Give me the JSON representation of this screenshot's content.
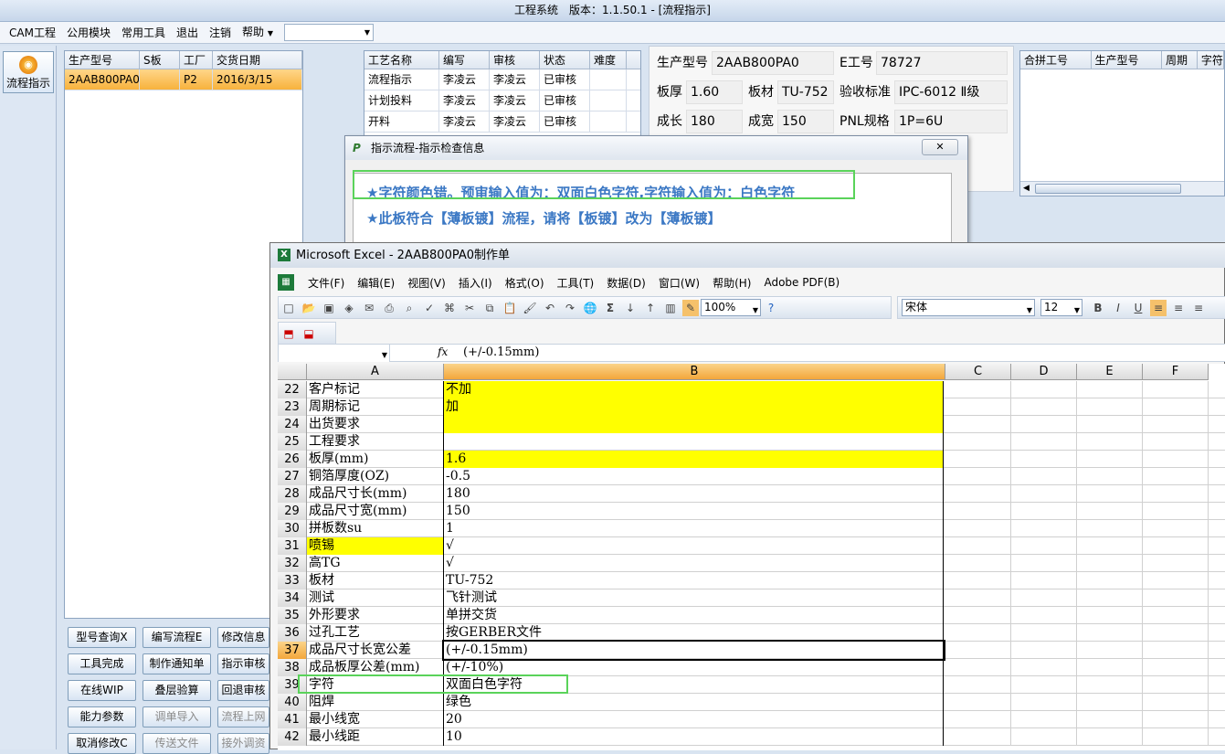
{
  "app": {
    "title": "工程系统　版本：1.1.50.1 - [流程指示]",
    "menu": [
      "CAM工程",
      "公用模块",
      "常用工具",
      "退出",
      "注销",
      "帮助"
    ]
  },
  "side": {
    "button_label": "流程指示"
  },
  "order_grid": {
    "headers": [
      "生产型号",
      "S板",
      "工厂",
      "交货日期"
    ],
    "rows": [
      [
        "2AAB800PA0",
        "",
        "P2",
        "2016/3/15"
      ]
    ]
  },
  "process_grid": {
    "headers": [
      "工艺名称",
      "编写",
      "审核",
      "状态",
      "难度"
    ],
    "rows": [
      [
        "流程指示",
        "李凌云",
        "李凌云",
        "已审核",
        ""
      ],
      [
        "计划投料",
        "李凌云",
        "李凌云",
        "已审核",
        ""
      ],
      [
        "开料",
        "李凌云",
        "李凌云",
        "已审核",
        ""
      ]
    ]
  },
  "info": {
    "model_label": "生产型号",
    "model_value": "2AAB800PA0",
    "e_label": "E工号",
    "e_value": "78727",
    "thickness_label": "板厚",
    "thickness_value": "1.60",
    "material_label": "板材",
    "material_value": "TU-752",
    "standard_label": "验收标准",
    "standard_value": "IPC-6012 Ⅱ级",
    "length_label": "成长",
    "length_value": "180",
    "width_label": "成宽",
    "width_value": "150",
    "pnl_label": "PNL规格",
    "pnl_value": "1P=6U"
  },
  "combine_grid": {
    "headers": [
      "合拼工号",
      "生产型号",
      "周期",
      "字符"
    ]
  },
  "buttons": [
    [
      "型号查询X",
      "编写流程E",
      "修改信息"
    ],
    [
      "工具完成",
      "制作通知单",
      "指示审核"
    ],
    [
      "在线WIP",
      "叠层验算",
      "回退审核"
    ],
    [
      "能力参数",
      "调单导入",
      "流程上网"
    ],
    [
      "取消修改C",
      "传送文件",
      "接外调资"
    ]
  ],
  "dialog": {
    "title": "指示流程-指示检查信息",
    "messages": [
      "★字符颜色错。预审输入值为：双面白色字符,字符输入值为：白色字符",
      "★此板符合【薄板镀】流程，请将【板镀】改为【薄板镀】"
    ]
  },
  "excel": {
    "title": "Microsoft Excel - 2AAB800PA0制作单",
    "menu": [
      "文件(F)",
      "编辑(E)",
      "视图(V)",
      "插入(I)",
      "格式(O)",
      "工具(T)",
      "数据(D)",
      "窗口(W)",
      "帮助(H)",
      "Adobe PDF(B)"
    ],
    "zoom": "100%",
    "font": "宋体",
    "font_size": "12",
    "formula": "(+/-0.15mm)",
    "columns": [
      "A",
      "B",
      "C",
      "D",
      "E",
      "F"
    ],
    "rows": [
      {
        "n": "22",
        "a": "客户标记",
        "b": "不加",
        "yb": true
      },
      {
        "n": "23",
        "a": "周期标记",
        "b": "加",
        "yb": true
      },
      {
        "n": "24",
        "a": "出货要求",
        "b": "",
        "yb": true
      },
      {
        "n": "25",
        "a": "工程要求",
        "b": ""
      },
      {
        "n": "26",
        "a": "板厚(mm)",
        "b": "1.6",
        "yb": true
      },
      {
        "n": "27",
        "a": "铜箔厚度(OZ)",
        "b": "-0.5"
      },
      {
        "n": "28",
        "a": "成品尺寸长(mm)",
        "b": "180"
      },
      {
        "n": "29",
        "a": "成品尺寸宽(mm)",
        "b": "150"
      },
      {
        "n": "30",
        "a": "拼板数su",
        "b": "1"
      },
      {
        "n": "31",
        "a": "喷锡",
        "b": "√",
        "ya": true
      },
      {
        "n": "32",
        "a": "高TG",
        "b": "√"
      },
      {
        "n": "33",
        "a": "板材",
        "b": "TU-752"
      },
      {
        "n": "34",
        "a": "测试",
        "b": "飞针测试"
      },
      {
        "n": "35",
        "a": "外形要求",
        "b": "单拼交货"
      },
      {
        "n": "36",
        "a": "过孔工艺",
        "b": "按GERBER文件"
      },
      {
        "n": "37",
        "a": "成品尺寸长宽公差",
        "b": "(+/-0.15mm)",
        "active": true
      },
      {
        "n": "38",
        "a": "成品板厚公差(mm)",
        "b": "(+/-10%)"
      },
      {
        "n": "39",
        "a": "字符",
        "b": "双面白色字符"
      },
      {
        "n": "40",
        "a": "阻焊",
        "b": "绿色"
      },
      {
        "n": "41",
        "a": "最小线宽",
        "b": "20"
      },
      {
        "n": "42",
        "a": "最小线距",
        "b": "10"
      }
    ]
  }
}
